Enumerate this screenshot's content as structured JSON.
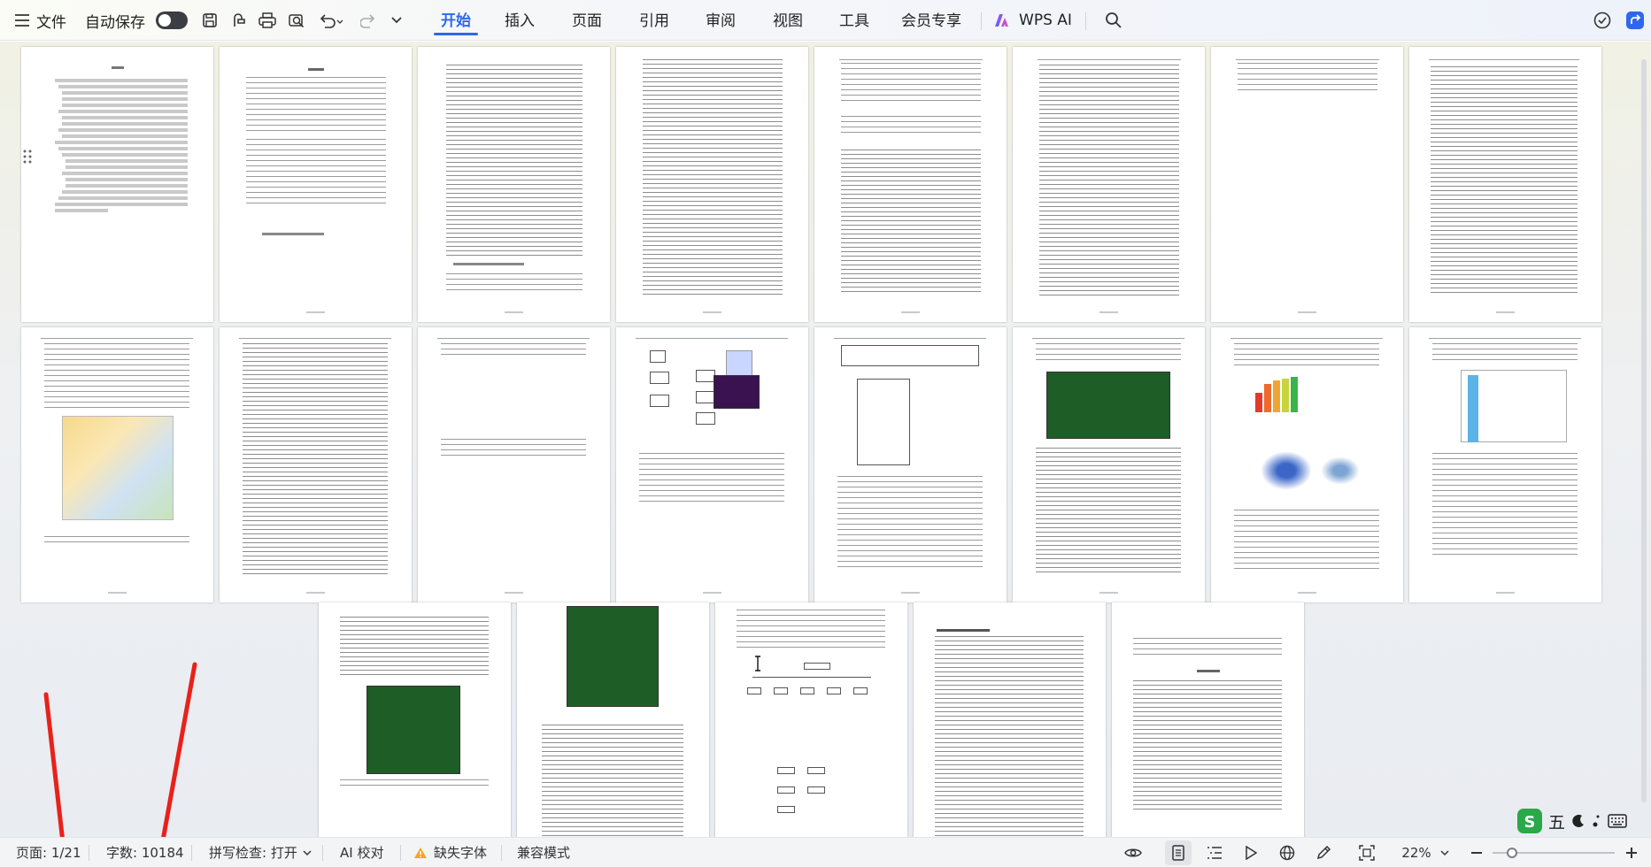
{
  "toolbar": {
    "file_label": "文件",
    "autosave_label": "自动保存",
    "wps_ai_label": "WPS AI"
  },
  "tabs": [
    {
      "label": "开始",
      "active": true
    },
    {
      "label": "插入",
      "active": false
    },
    {
      "label": "页面",
      "active": false
    },
    {
      "label": "引用",
      "active": false
    },
    {
      "label": "审阅",
      "active": false
    },
    {
      "label": "视图",
      "active": false
    },
    {
      "label": "工具",
      "active": false
    },
    {
      "label": "会员专享",
      "active": false
    }
  ],
  "icons": [
    "menu-icon",
    "save-icon",
    "export-icon",
    "print-icon",
    "print-preview-icon",
    "undo-icon",
    "redo-icon",
    "more-dropdown-icon",
    "wps-ai-logo-icon",
    "search-icon",
    "cloud-sync-icon",
    "share-icon",
    "eye-icon",
    "page-view-icon",
    "outline-icon",
    "play-icon",
    "web-icon",
    "pen-icon",
    "fit-page-icon",
    "zoom-out-icon",
    "zoom-in-icon",
    "warning-icon"
  ],
  "status": {
    "page": "页面: 1/21",
    "words": "字数: 10184",
    "spellcheck": "拼写检查: 打开",
    "ai_proofread": "AI 校对",
    "missing_font": "缺失字体",
    "compat_mode": "兼容模式",
    "zoom": "22%"
  },
  "ime": {
    "label": "五"
  },
  "colors": {
    "accent": "#2f68e8",
    "annotation_arrow": "#e8211a"
  }
}
